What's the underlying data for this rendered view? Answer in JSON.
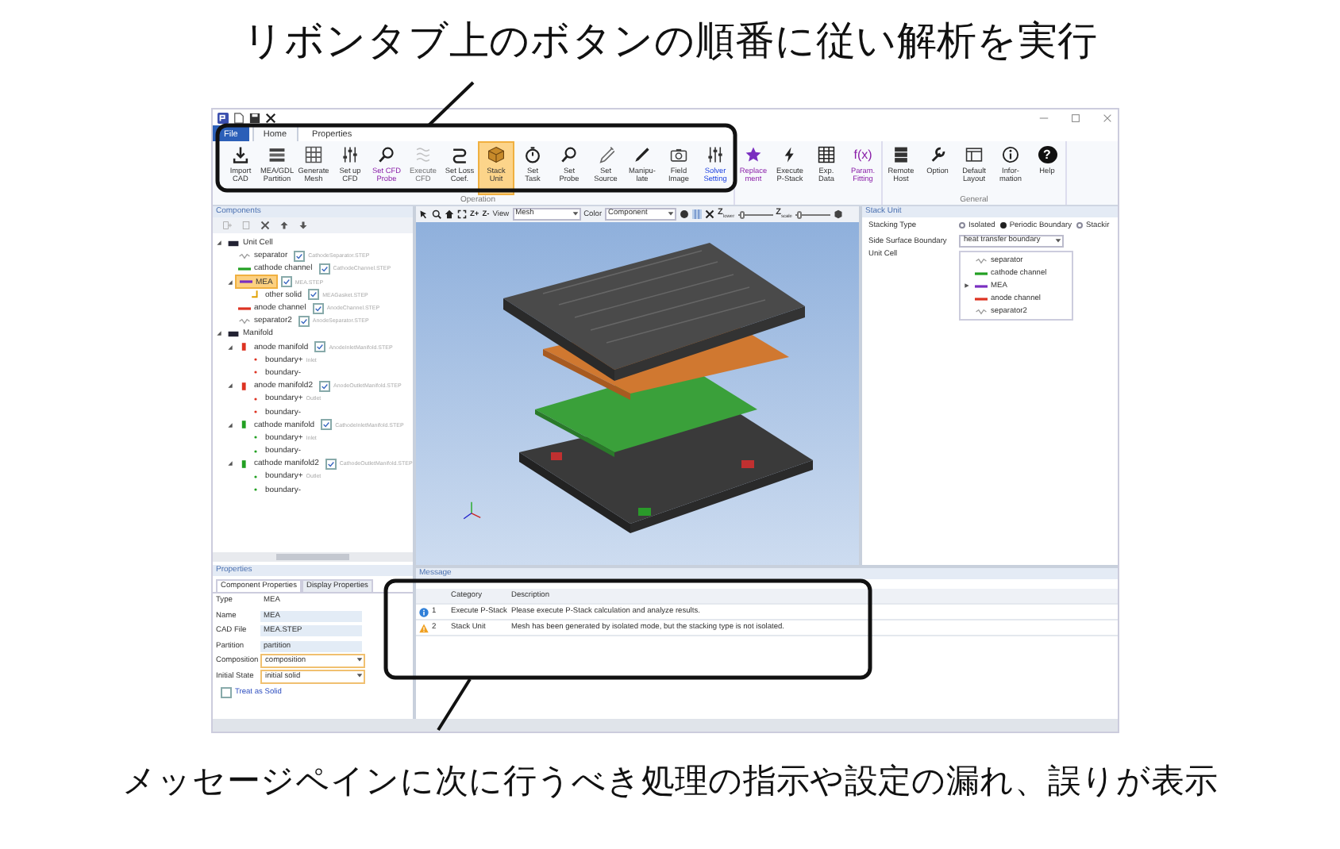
{
  "top_caption": "リボンタブ上のボタンの順番に従い解析を実行",
  "bottom_caption": "メッセージペインに次に行うべき処理の指示や設定の漏れ、誤りが表示",
  "ribbon_tabs": [
    {
      "label": "File",
      "selected": false,
      "kind": "file"
    },
    {
      "label": "Home",
      "selected": true,
      "kind": "tab"
    },
    {
      "label": "Properties",
      "selected": false,
      "kind": "tab"
    }
  ],
  "ribbon_groups": [
    {
      "label": "Operation",
      "buttons": [
        {
          "label": [
            "Import",
            "CAD"
          ],
          "kind": "plain",
          "selected": false,
          "disabled": false
        },
        {
          "label": [
            "MEA/GDL",
            "Partition"
          ],
          "kind": "plain",
          "selected": false,
          "disabled": false
        },
        {
          "label": [
            "Generate",
            "Mesh"
          ],
          "kind": "plain",
          "selected": false,
          "disabled": false
        },
        {
          "label": [
            "Set up",
            "CFD"
          ],
          "kind": "plain",
          "selected": false,
          "disabled": false
        },
        {
          "label": [
            "Set CFD",
            "Probe"
          ],
          "kind": "optional",
          "selected": false,
          "disabled": false
        },
        {
          "label": [
            "Execute",
            "CFD"
          ],
          "kind": "plain",
          "selected": false,
          "disabled": true
        },
        {
          "label": [
            "Set Loss",
            "Coef."
          ],
          "kind": "plain",
          "selected": false,
          "disabled": false
        },
        {
          "label": [
            "Stack",
            "Unit"
          ],
          "kind": "plain",
          "selected": true,
          "disabled": false
        },
        {
          "label": [
            "Set",
            "Task"
          ],
          "kind": "plain",
          "selected": false,
          "disabled": false
        },
        {
          "label": [
            "Set",
            "Probe"
          ],
          "kind": "plain",
          "selected": false,
          "disabled": false
        },
        {
          "label": [
            "Set",
            "Source"
          ],
          "kind": "plain",
          "selected": false,
          "disabled": false
        },
        {
          "label": [
            "Manipu-",
            "late"
          ],
          "kind": "plain",
          "selected": false,
          "disabled": false
        },
        {
          "label": [
            "Field",
            "Image"
          ],
          "kind": "plain",
          "selected": false,
          "disabled": false
        },
        {
          "label": [
            "Solver",
            "Setting"
          ],
          "kind": "solver",
          "selected": false,
          "disabled": false
        }
      ]
    },
    {
      "buttons": [
        {
          "label": [
            "Replace",
            "ment"
          ],
          "kind": "optional",
          "selected": false,
          "disabled": false
        },
        {
          "label": [
            "Execute",
            "P-Stack"
          ],
          "kind": "plain",
          "selected": false,
          "disabled": false
        },
        {
          "label": [
            "Exp.",
            "Data"
          ],
          "kind": "plain",
          "selected": false,
          "disabled": false
        },
        {
          "label": [
            "Param.",
            "Fitting"
          ],
          "kind": "optional",
          "selected": false,
          "disabled": false,
          "glyph": "f(x)"
        }
      ]
    },
    {
      "label": "General",
      "buttons": [
        {
          "label": [
            "Remote",
            "Host"
          ],
          "kind": "plain",
          "selected": false,
          "disabled": false
        },
        {
          "label": [
            "Option"
          ],
          "kind": "plain",
          "selected": false,
          "disabled": false
        },
        {
          "label": [
            "Default",
            "Layout"
          ],
          "kind": "plain",
          "selected": false,
          "disabled": false
        },
        {
          "label": [
            "Infor-",
            "mation"
          ],
          "kind": "plain",
          "selected": false,
          "disabled": false
        },
        {
          "label": [
            "Help"
          ],
          "kind": "plain",
          "selected": false,
          "disabled": false,
          "glyph": "?"
        }
      ]
    }
  ],
  "components_panel": {
    "title": "Components",
    "tree": [
      {
        "name": "Unit Cell",
        "kind": "group",
        "selected": false,
        "expanded": true,
        "children": [
          {
            "name": "separator",
            "kind": "wave",
            "selected": false,
            "checked": true,
            "file": "CathodeSeparator.STEP"
          },
          {
            "name": "cathode channel",
            "kind": "part",
            "color": "#22a022",
            "selected": false,
            "checked": true,
            "file": "CathodeChannel.STEP"
          },
          {
            "name": "MEA",
            "kind": "part",
            "color": "#7a2fc0",
            "selected": true,
            "checked": true,
            "file": "MEA.STEP",
            "expanded": true,
            "children": [
              {
                "name": "other solid",
                "kind": "corner",
                "selected": false,
                "checked": true,
                "file": "MEAGasket.STEP"
              }
            ]
          },
          {
            "name": "anode channel",
            "kind": "part",
            "color": "#dd3322",
            "selected": false,
            "checked": true,
            "file": "AnodeChannel.STEP"
          },
          {
            "name": "separator2",
            "kind": "wave",
            "selected": false,
            "checked": true,
            "file": "AnodeSeparator.STEP"
          }
        ]
      },
      {
        "name": "Manifold",
        "kind": "group",
        "selected": false,
        "expanded": true,
        "children": [
          {
            "name": "anode manifold",
            "kind": "block",
            "color": "#dd3322",
            "selected": false,
            "checked": true,
            "file": "AnodeInletManifold.STEP",
            "expanded": true,
            "children": [
              {
                "name": "boundary+",
                "kind": "boundary",
                "selected": false,
                "note": "Inlet"
              },
              {
                "name": "boundary-",
                "kind": "boundary",
                "selected": false
              }
            ]
          },
          {
            "name": "anode manifold2",
            "kind": "block",
            "color": "#dd3322",
            "selected": false,
            "checked": true,
            "file": "AnodeOutletManifold.STEP",
            "expanded": true,
            "children": [
              {
                "name": "boundary+",
                "kind": "boundary",
                "selected": false,
                "note": "Outlet"
              },
              {
                "name": "boundary-",
                "kind": "boundary",
                "selected": false
              }
            ]
          },
          {
            "name": "cathode manifold",
            "kind": "block",
            "color": "#22a022",
            "selected": false,
            "checked": true,
            "file": "CathodeInletManifold.STEP",
            "expanded": true,
            "children": [
              {
                "name": "boundary+",
                "kind": "boundary",
                "selected": false,
                "note": "Inlet"
              },
              {
                "name": "boundary-",
                "kind": "boundary",
                "selected": false
              }
            ]
          },
          {
            "name": "cathode manifold2",
            "kind": "block",
            "color": "#22a022",
            "selected": false,
            "checked": true,
            "file": "CathodeOutletManifold.STEP",
            "expanded": true,
            "children": [
              {
                "name": "boundary+",
                "kind": "boundary",
                "selected": false,
                "note": "Outlet"
              },
              {
                "name": "boundary-",
                "kind": "boundary",
                "selected": false
              }
            ]
          }
        ]
      }
    ]
  },
  "properties_panel": {
    "title": "Properties",
    "tabs": [
      {
        "label": "Component Properties",
        "selected": true
      },
      {
        "label": "Display Properties",
        "selected": false
      }
    ],
    "rows": [
      {
        "label": "Type",
        "value": "MEA",
        "kind": "text"
      },
      {
        "label": "Name",
        "value": "MEA",
        "kind": "field"
      },
      {
        "label": "CAD File",
        "value": "MEA.STEP",
        "kind": "field"
      },
      {
        "label": "Partition",
        "value": "partition",
        "kind": "field"
      },
      {
        "label": "Composition",
        "value": "composition",
        "kind": "dropdown"
      },
      {
        "label": "Initial State",
        "value": "initial solid",
        "kind": "dropdown"
      }
    ],
    "treat_as_solid": {
      "label": "Treat as Solid",
      "checked": false
    }
  },
  "viewport": {
    "zoom_buttons": [
      "Z+",
      "Z-"
    ],
    "view_label": "View",
    "view_value": "Mesh",
    "color_label": "Color",
    "color_value": "Component",
    "sliders": [
      {
        "label": "Z$_{lower}$",
        "level": 0.05
      },
      {
        "label": "Z$_{scale}$",
        "level": 0.05
      }
    ]
  },
  "stack_unit_panel": {
    "title": "Stack Unit",
    "stacking_label": "Stacking Type",
    "stacking_options": [
      {
        "label": "Isolated",
        "selected": false
      },
      {
        "label": "Periodic Boundary",
        "selected": true
      },
      {
        "label": "Stackir",
        "selected": false
      }
    ],
    "side_label": "Side Surface Boundary",
    "side_value": "heat transfer boundary",
    "unit_cell_label": "Unit Cell",
    "unit_cell": [
      {
        "name": "separator",
        "kind": "wave"
      },
      {
        "name": "cathode channel",
        "kind": "part",
        "color": "#22a022"
      },
      {
        "name": "MEA",
        "kind": "part",
        "color": "#7a2fc0",
        "expanded": false
      },
      {
        "name": "anode channel",
        "kind": "part",
        "color": "#dd3322"
      },
      {
        "name": "separator2",
        "kind": "wave"
      }
    ]
  },
  "message_panel": {
    "title": "Message",
    "columns": [
      "Category",
      "Description"
    ],
    "rows": [
      {
        "kind": "info",
        "number": "1",
        "category": "Execute P-Stack",
        "description": "Please execute P-Stack calculation and analyze results."
      },
      {
        "kind": "warning",
        "number": "2",
        "category": "Stack Unit",
        "description": "Mesh has been generated by isolated mode, but the stacking type is not isolated."
      }
    ]
  }
}
